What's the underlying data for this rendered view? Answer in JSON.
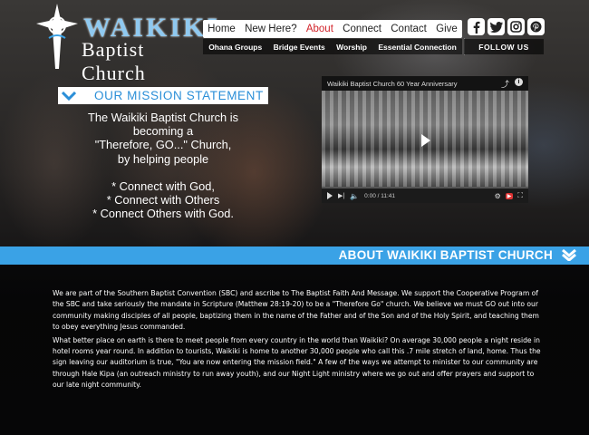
{
  "site": {
    "logo_name": "WAIKIKI",
    "logo_sub": "Baptist Church"
  },
  "nav": {
    "items": [
      {
        "label": "Home"
      },
      {
        "label": "New Here?"
      },
      {
        "label": "About",
        "active": true
      },
      {
        "label": "Connect"
      },
      {
        "label": "Contact"
      },
      {
        "label": "Give"
      }
    ],
    "subnav": [
      {
        "label": "Ohana Groups"
      },
      {
        "label": "Bridge Events"
      },
      {
        "label": "Worship"
      },
      {
        "label": "Essential Connection"
      }
    ]
  },
  "social": {
    "icons": [
      "facebook-icon",
      "twitter-icon",
      "instagram-icon",
      "pinterest-icon"
    ],
    "follow_label": "FOLLOW US"
  },
  "mission": {
    "title": "OUR MISSION STATEMENT",
    "lines": [
      "The Waikiki Baptist Church is",
      "becoming a",
      "\"Therefore, GO...\" Church,",
      "by helping people"
    ],
    "points": [
      "* Connect with God,",
      "* Connect with Others",
      "* Connect Others with God."
    ]
  },
  "video": {
    "title": "Waikiki Baptist Church 60 Year Anniversary",
    "time": "0:00 / 11:41"
  },
  "about": {
    "title": "ABOUT WAIKIKI BAPTIST CHURCH",
    "paragraphs": [
      "We are part of the Southern Baptist Convention (SBC) and ascribe to The Baptist Faith And Message. We support the Cooperative Program of the SBC and take seriously the mandate in Scripture (Matthew 28:19-20) to be a \"Therefore Go\" church. We believe we must GO out into our community making disciples of all people, baptizing them in the name of the Father and of the Son and of the Holy Spirit, and teaching them to obey everything Jesus commanded.",
      "What better place on earth is there to meet people from every country in the world than Waikiki? On average 30,000 people a night reside in hotel rooms year round. In addition to tourists, Waikiki is home to another 30,000 people who call this .7 mile stretch of land, home. Thus the sign leaving our auditorium is true, \"You are now entering the mission field.\" A few of the ways we attempt to minister to our community are through Hale Kipa (an outreach ministry to run away youth), and our Night Light ministry where we go out and offer prayers and support to our late night community."
    ]
  },
  "colors": {
    "accent_blue": "#3aa2e6",
    "active_nav": "#d2232a"
  }
}
